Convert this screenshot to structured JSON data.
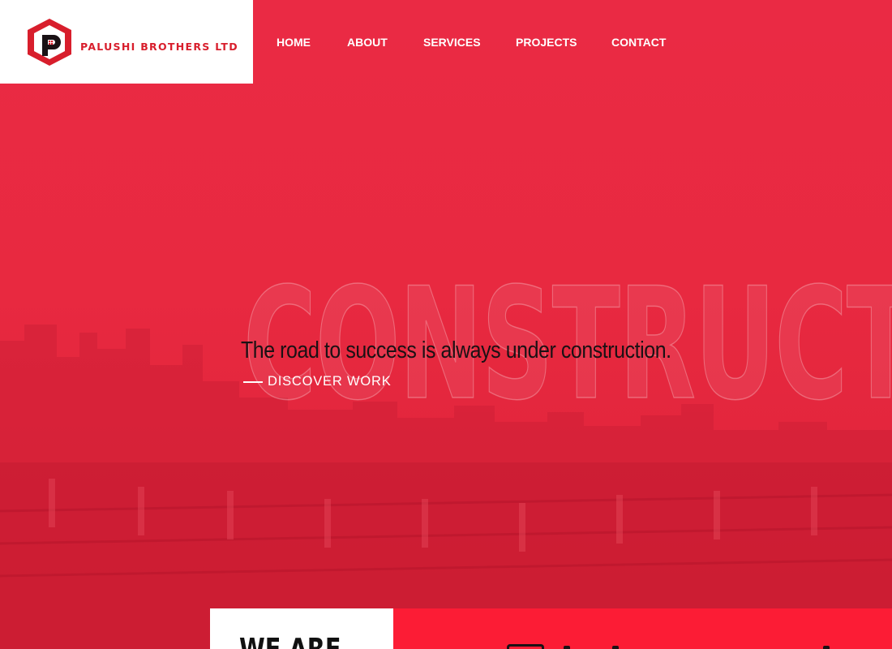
{
  "brand": {
    "name": "PALUSHI BROTHERS LTD",
    "logo_icon": "house-p-hexagon-logo",
    "accent_color": "#d81e2c"
  },
  "nav": {
    "items": [
      {
        "label": "HOME"
      },
      {
        "label": "ABOUT"
      },
      {
        "label": "SERVICES"
      },
      {
        "label": "PROJECTS"
      },
      {
        "label": "CONTACT"
      }
    ]
  },
  "hero": {
    "background_word": "CONSTRUCTI",
    "tagline": "The road to success is always under construction.",
    "cta_label": "DISCOVER WORK",
    "overlay_color": "#e8283f"
  },
  "about": {
    "heading": "WE ARE"
  }
}
